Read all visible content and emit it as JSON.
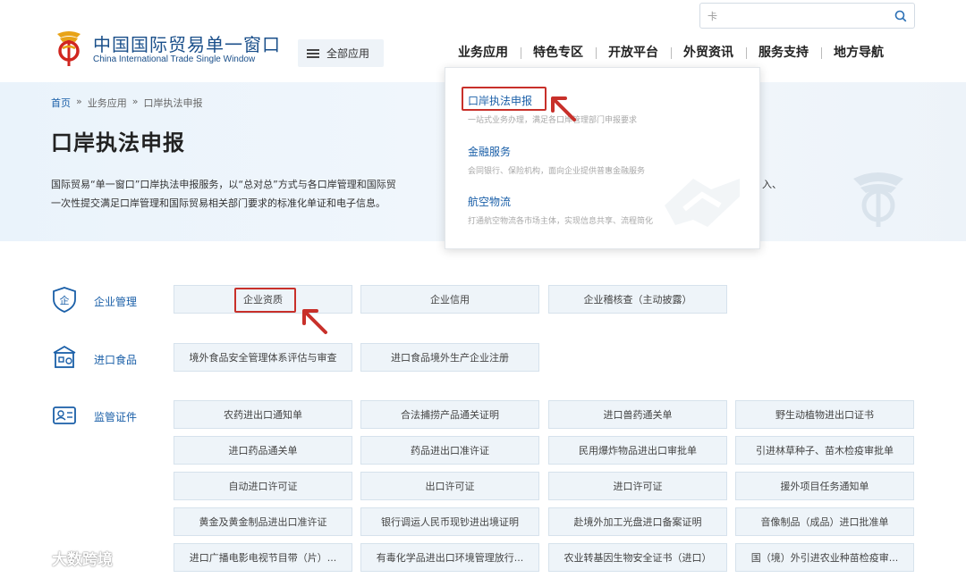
{
  "header": {
    "brand_cn": "中国国际贸易单一窗口",
    "brand_en": "China International Trade Single Window",
    "all_apps_label": "全部应用",
    "search_value": "卡",
    "nav": [
      "业务应用",
      "特色专区",
      "开放平台",
      "外贸资讯",
      "服务支持",
      "地方导航"
    ]
  },
  "breadcrumb": {
    "home": "首页",
    "sep": "»",
    "level2": "业务应用",
    "current": "口岸执法申报"
  },
  "page_title": "口岸执法申报",
  "description": {
    "line1": "国际贸易“单一窗口”口岸执法申报服务，以“总对总”方式与各口岸管理和国际贸",
    "line1_tail": "入、",
    "line2": "一次性提交满足口岸管理和国际贸易相关部门要求的标准化单证和电子信息。"
  },
  "dropdown": [
    {
      "title": "口岸执法申报",
      "sub": "一站式业务办理，满足各口岸管理部门申报要求"
    },
    {
      "title": "金融服务",
      "sub": "会同银行、保险机构，面向企业提供普惠金融服务"
    },
    {
      "title": "航空物流",
      "sub": "打通航空物流各市场主体，实现信息共享、流程简化"
    }
  ],
  "categories": {
    "enterprise": {
      "label": "企业管理",
      "icon_char": "企",
      "items": [
        "企业资质",
        "企业信用",
        "企业稽核查（主动披露）"
      ]
    },
    "food": {
      "label": "进口食品",
      "items": [
        "境外食品安全管理体系评估与审查",
        "进口食品境外生产企业注册"
      ]
    },
    "certs": {
      "label": "监管证件",
      "items": [
        "农药进出口通知单",
        "合法捕捞产品通关证明",
        "进口兽药通关单",
        "野生动植物进出口证书",
        "进口药品通关单",
        "药品进出口准许证",
        "民用爆炸物品进出口审批单",
        "引进林草种子、苗木检疫审批单",
        "自动进口许可证",
        "出口许可证",
        "进口许可证",
        "援外项目任务通知单",
        "黄金及黄金制品进出口准许证",
        "银行调运人民币现钞进出境证明",
        "赴境外加工光盘进口备案证明",
        "音像制品（成品）进口批准单",
        "进口广播电影电视节目带（片）...",
        "有毒化学品进出口环境管理放行...",
        "农业转基因生物安全证书（进口）",
        "国（境）外引进农业种苗检疫审..."
      ]
    }
  },
  "watermark": "大数跨境",
  "colors": {
    "brand_blue": "#1a5fa8",
    "highlight_red": "#c8302a",
    "chip_bg": "#eef4f9"
  }
}
